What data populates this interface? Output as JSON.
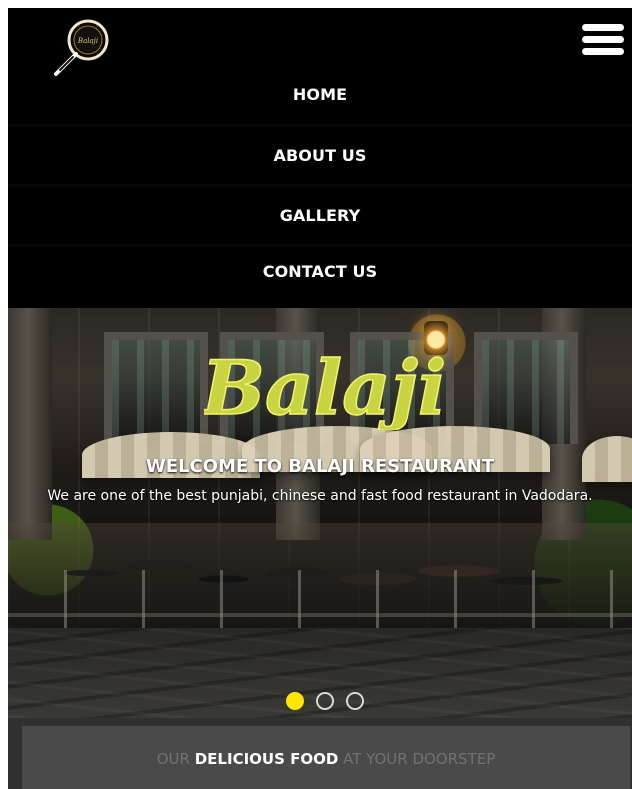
{
  "brand": {
    "logo_text": "Balaji",
    "hero_logo_text": "Balaji"
  },
  "navigation": {
    "items": [
      {
        "label": "HOME"
      },
      {
        "label": "ABOUT US"
      },
      {
        "label": "GALLERY"
      },
      {
        "label": "CONTACT US"
      }
    ]
  },
  "hero": {
    "title": "WELCOME TO BALAJI RESTAURANT",
    "subtitle": "We are one of the best punjabi, chinese and fast food restaurant in Vadodara.",
    "active_slide": 1,
    "slide_count": 3
  },
  "banner": {
    "part1": "OUR",
    "part2": "DELICIOUS FOOD",
    "part3": "AT YOUR DOORSTEP"
  },
  "colors": {
    "background": "#000000",
    "accent_yellow": "#ffe600",
    "banner_gray": "#4a4a4a",
    "muted_text": "#727272",
    "white": "#ffffff"
  },
  "icons": {
    "logo": "frying-pan-logo-icon",
    "menu": "hamburger-menu-icon",
    "slide_indicators": "carousel-dot-icon"
  }
}
